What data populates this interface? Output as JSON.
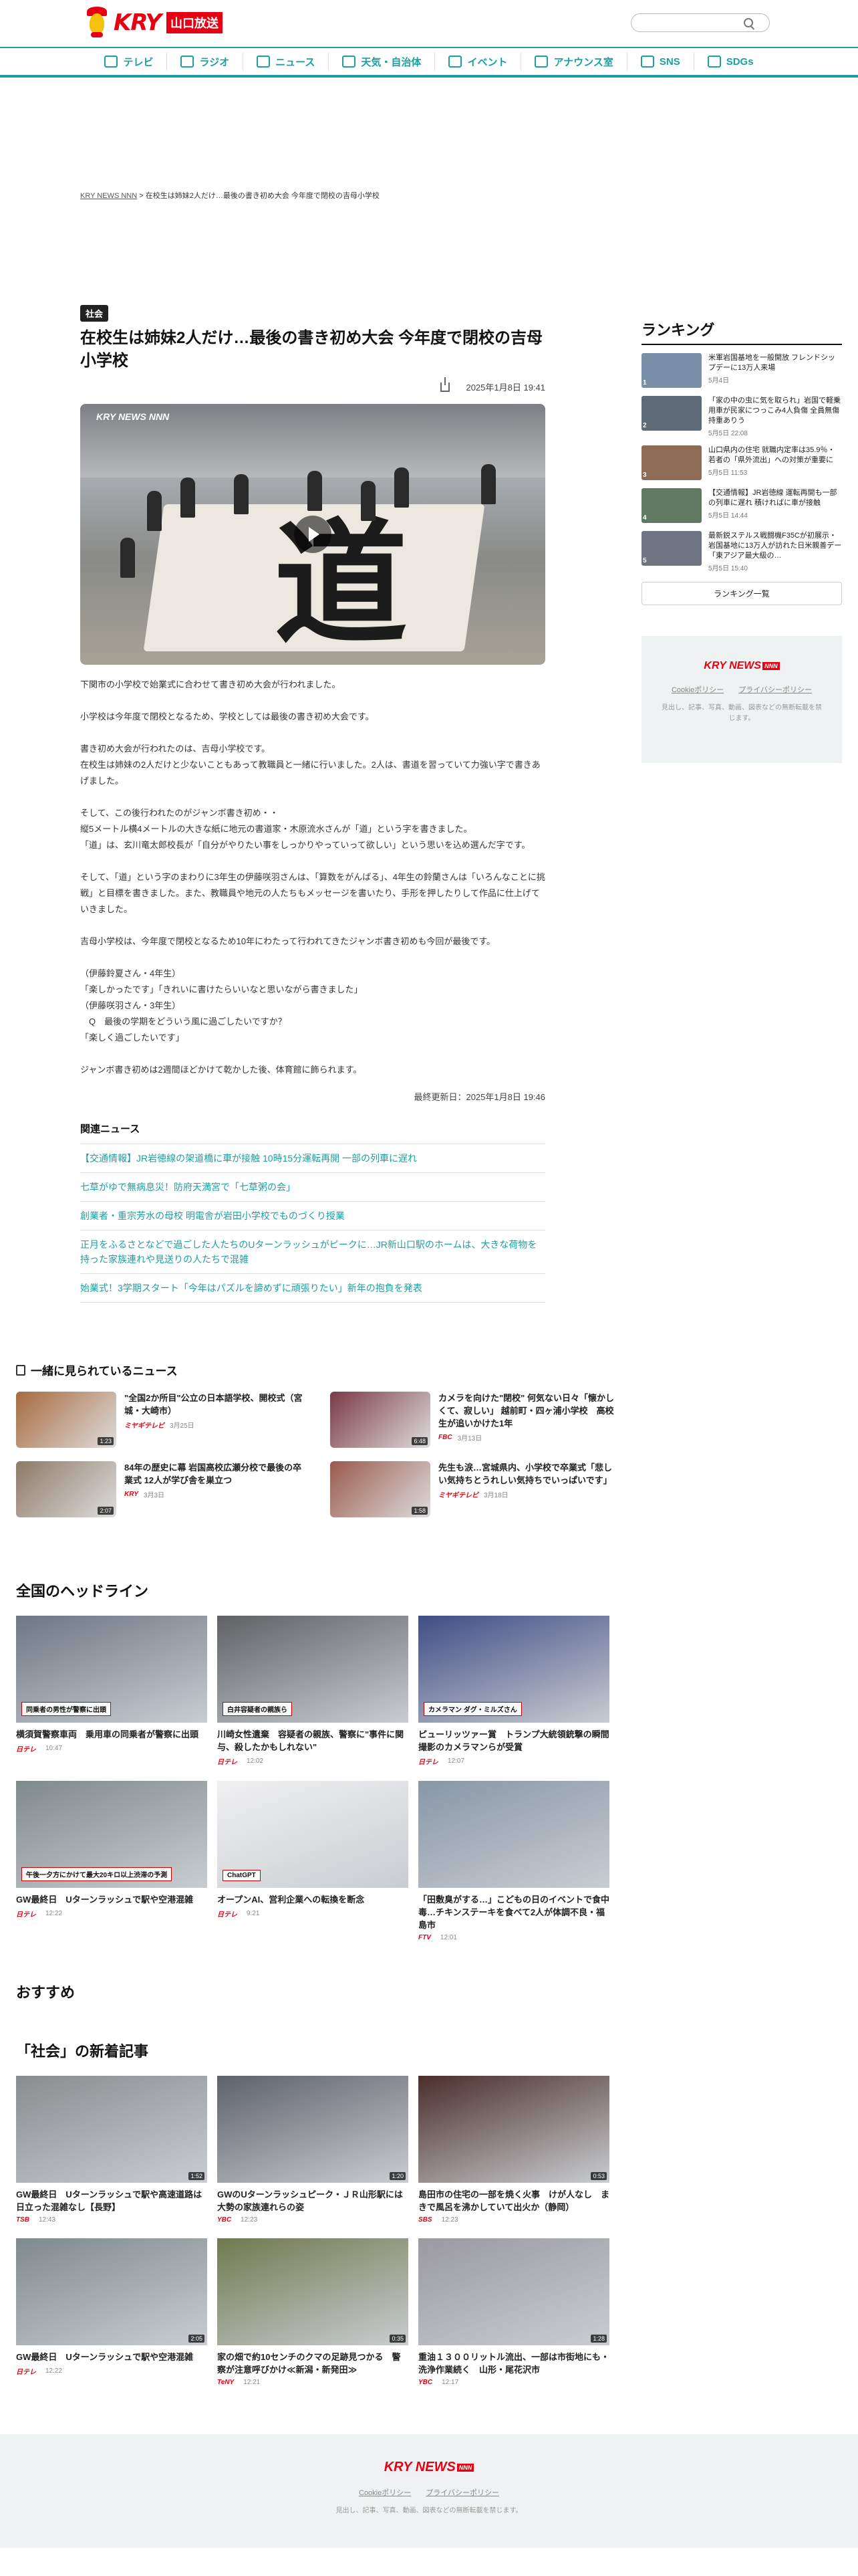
{
  "header": {
    "logo_text": "KRY",
    "logo_sub": "山口放送",
    "search_placeholder": ""
  },
  "nav": [
    {
      "label": "テレビ",
      "icon": "tv-icon"
    },
    {
      "label": "ラジオ",
      "icon": "radio-icon"
    },
    {
      "label": "ニュース",
      "icon": "news-icon"
    },
    {
      "label": "天気・自治体",
      "icon": "weather-icon"
    },
    {
      "label": "イベント",
      "icon": "event-icon"
    },
    {
      "label": "アナウンス室",
      "icon": "mic-icon"
    },
    {
      "label": "SNS",
      "icon": "sns-icon"
    },
    {
      "label": "SDGs",
      "icon": "sdgs-icon"
    }
  ],
  "breadcrumb": {
    "home": "KRY NEWS NNN",
    "sep": ">",
    "current": "在校生は姉妹2人だけ…最後の書き初め大会 今年度で閉校の吉母小学校"
  },
  "article": {
    "category": "社会",
    "title": "在校生は姉妹2人だけ…最後の書き初め大会 今年度で閉校の吉母小学校",
    "date": "2025年1月8日 19:41",
    "video_brand": "KRY NEWS NNN",
    "paragraphs": [
      "下関市の小学校で始業式に合わせて書き初め大会が行われました。",
      "小学校は今年度で閉校となるため、学校としては最後の書き初め大会です。",
      "書き初め大会が行われたのは、吉母小学校です。\n在校生は姉妹の2人だけと少ないこともあって教職員と一緒に行いました。2人は、書道を習っていて力強い字で書きあげました。",
      "そして、この後行われたのがジャンボ書き初め・・\n縦5メートル横4メートルの大きな紙に地元の書道家・木原流水さんが「道」という字を書きました。\n「道」は、玄川竜太郎校長が「自分がやりたい事をしっかりやっていって欲しい」という思いを込め選んだ字です。",
      "そして、「道」という字のまわりに3年生の伊藤咲羽さんは、「算数をがんばる」、4年生の鈴蘭さんは「いろんなことに挑戦」と目標を書きました。また、教職員や地元の人たちもメッセージを書いたり、手形を押したりして作品に仕上げていきました。",
      "吉母小学校は、今年度で閉校となるため10年にわたって行われてきたジャンボ書き初めも今回が最後です。",
      "（伊藤鈴夏さん・4年生）\n「楽しかったです」「きれいに書けたらいいなと思いながら書きました」\n（伊藤咲羽さん・3年生）\n　Q　最後の学期をどういう風に過ごしたいですか？\n「楽しく過ごしたいです」",
      "ジャンボ書き初めは2週間ほどかけて乾かした後、体育館に飾られます。"
    ],
    "updated": "最終更新日：2025年1月8日 19:46"
  },
  "related": {
    "title": "関連ニュース",
    "items": [
      "【交通情報】JR岩徳線の架道橋に車が接触 10時15分運転再開 一部の列車に遅れ",
      "七草がゆで無病息災！防府天満宮で「七草粥の会」",
      "創業者・重宗芳水の母校 明電舎が岩田小学校でものづくり授業",
      "正月をふるさとなどで過ごした人たちのUターンラッシュがピークに…JR新山口駅のホームは、大きな荷物を持った家族連れや見送りの人たちで混雑",
      "始業式！3学期スタート「今年はパズルを諦めずに頑張りたい」新年の抱負を発表"
    ]
  },
  "ranking": {
    "title": "ランキング",
    "items": [
      {
        "text": "米軍岩国基地を一般開放 フレンドシップデーに13万人来場",
        "date": "5月4日",
        "color": "#7a8fa8",
        "num": "1"
      },
      {
        "text": "「家の中の虫に気を取られ」岩国で軽乗用車が民家につっこみ4人負傷 全員無傷持重ありう",
        "date": "5月5日 22:08",
        "color": "#5d6a78",
        "num": "2"
      },
      {
        "text": "山口県内の住宅 就職内定率は35.9％・若者の「県外流出」への対策が重要に",
        "date": "5月5日 11:53",
        "color": "#8e6b55",
        "num": "3"
      },
      {
        "text": "【交通情報】JR岩徳線 運転再開も一部の列車に遅れ 積ければに車が接触",
        "date": "5月5日 14:44",
        "color": "#607a62",
        "num": "4"
      },
      {
        "text": "最新鋭ステルス戦闘機F35Cが初展示・岩国基地に13万人が訪れた日米親善デー「東アジア最大級の…",
        "date": "5月5日 15:40",
        "color": "#6e7480",
        "num": "5"
      }
    ],
    "more": "ランキング一覧"
  },
  "side_footer": {
    "logo": "KRY NEWS",
    "tag": "NNN",
    "cookie": "Cookieポリシー",
    "privacy": "プライバシーポリシー",
    "rights": "見出し、記事、写真、動画、図表などの無断転載を禁じます。"
  },
  "together": {
    "title": "一緒に見られているニュース",
    "items": [
      {
        "text": "\"全国2か所目\"公立の日本語学校、開校式（宮城・大崎市）",
        "src": "ミヤギテレビ",
        "date": "3月25日",
        "dur": "1:23",
        "color": "#a86a3e"
      },
      {
        "text": "カメラを向けた\"閉校\" 何気ない日々「懐かしくて、寂しい」 越前町・四ヶ浦小学校　高校生が追いかけた1年",
        "src": "FBC",
        "date": "3月13日",
        "dur": "6:48",
        "color": "#7b3a44"
      },
      {
        "text": "84年の歴史に幕 岩国高校広瀬分校で最後の卒業式 12人が学び舎を巣立つ",
        "src": "KRY",
        "date": "3月3日",
        "dur": "2:07",
        "color": "#8e7a66"
      },
      {
        "text": "先生も涙…宮城県内、小学校で卒業式「悲しい気持ちとうれしい気持ちでいっぱいです」",
        "src": "ミヤギテレビ",
        "date": "3月18日",
        "dur": "1:58",
        "color": "#9a5a4b"
      }
    ]
  },
  "headlines": {
    "title": "全国のヘッドライン",
    "items": [
      {
        "text": "横須賀警察車両　乗用車の同乗者が警察に出頭",
        "src": "日テレ",
        "date": "10:47",
        "cap": "同乗者の男性が警察に出頭",
        "color": "#6d7884"
      },
      {
        "text": "川崎女性遺棄　容疑者の親族、警察に\"事件に関与、殺したかもしれない\"",
        "src": "日テレ",
        "date": "12:02",
        "cap": "白井容疑者の親族ら",
        "color": "#5f6165"
      },
      {
        "text": "ピューリッツァー賞　トランプ大統領銃撃の瞬間撮影のカメラマンらが受賞",
        "src": "日テレ",
        "date": "12:07",
        "cap": "カメラマン ダグ・ミルズさん",
        "color": "#3f4d86"
      },
      {
        "text": "GW最終日　Uターンラッシュで駅や空港混雑",
        "src": "日テレ",
        "date": "12:22",
        "cap": "午後一夕方にかけて最大20キロ以上渋滞の予測",
        "color": "#7f8a8c"
      },
      {
        "text": "オープンAI、営利企業への転換を断念",
        "src": "日テレ",
        "date": "9:21",
        "cap": "ChatGPT",
        "color": "#f0f0f2"
      },
      {
        "text": "「田敷臭がする…」こどもの日のイベントで食中毒…チキンステーキを食べて2人が体調不良・福島市",
        "src": "FTV",
        "date": "12:01",
        "cap": "",
        "color": "#8797a8"
      }
    ]
  },
  "recommend": {
    "title": "おすすめ"
  },
  "latest": {
    "title": "「社会」の新着記事",
    "items": [
      {
        "text": "GW最終日　Uターンラッシュで駅や高速道路は日立った混雑なし【長野】",
        "src": "TSB",
        "date": "12:43",
        "dur": "1:52",
        "color": "#8a8d90"
      },
      {
        "text": "GWのUターンラッシュピーク・ＪＲ山形駅には大勢の家族連れらの姿",
        "src": "YBC",
        "date": "12:23",
        "dur": "1:20",
        "color": "#5e6269"
      },
      {
        "text": "島田市の住宅の一部を焼く火事　けが人なし　まきで風呂を沸かしていて出火か（静岡）",
        "src": "SBS",
        "date": "12:23",
        "dur": "0:53",
        "color": "#4a2e2a"
      },
      {
        "text": "GW最終日　Uターンラッシュで駅や空港混雑",
        "src": "日テレ",
        "date": "12:22",
        "dur": "2:05",
        "color": "#7f8a8c"
      },
      {
        "text": "家の畑で約10センチのクマの足跡見つかる　警察が注意呼びかけ≪新潟・新発田≫",
        "src": "TeNY",
        "date": "12:21",
        "dur": "0:35",
        "color": "#6f7a4e"
      },
      {
        "text": "重油１３００リットル流出、一部は市街地にも・洗浄作業続く　山形・尾花沢市",
        "src": "YBC",
        "date": "12:17",
        "dur": "1:28",
        "color": "#9a9aa0"
      }
    ]
  },
  "footer": {
    "logo": "KRY NEWS",
    "tag": "NNN",
    "cookie": "Cookieポリシー",
    "privacy": "プライバシーポリシー",
    "rights": "見出し、記事、写真、動画、図表などの無断転載を禁じます。"
  },
  "bottom_bar": {
    "close": "×"
  }
}
